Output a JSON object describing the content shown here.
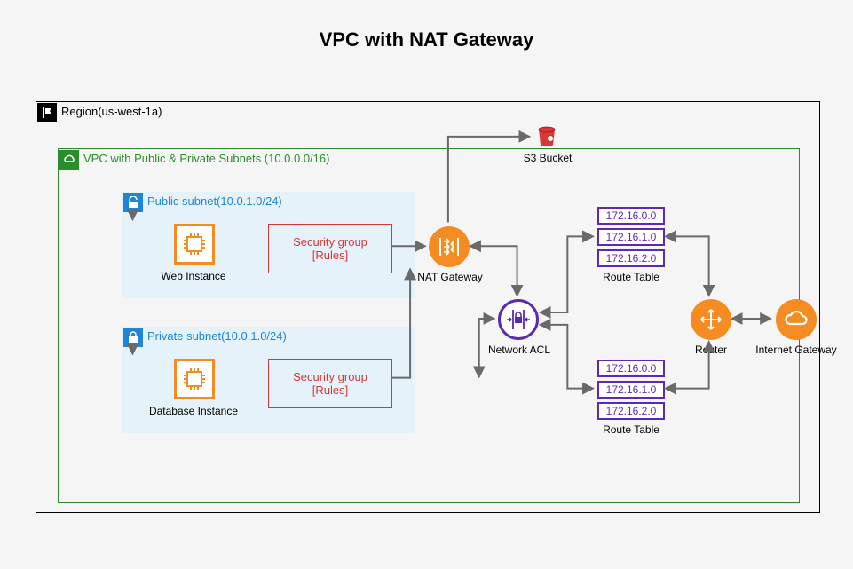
{
  "title": "VPC with NAT Gateway",
  "region": {
    "label": "Region(us-west-1a)"
  },
  "vpc": {
    "label": "VPC with Public & Private Subnets (10.0.0.0/16)"
  },
  "public_subnet": {
    "label": "Public subnet(10.0.1.0/24)"
  },
  "private_subnet": {
    "label": "Private subnet(10.0.1.0/24)"
  },
  "web_instance": {
    "label": "Web Instance"
  },
  "db_instance": {
    "label": "Database Instance"
  },
  "secgroup1": {
    "title": "Security group",
    "rules": "[Rules]"
  },
  "secgroup2": {
    "title": "Security group",
    "rules": "[Rules]"
  },
  "nat": {
    "label": "NAT Gateway"
  },
  "nacl": {
    "label": "Network ACL"
  },
  "s3": {
    "label": "S3 Bucket"
  },
  "router": {
    "label": "Router"
  },
  "igw": {
    "label": "Internet Gateway"
  },
  "route_table_top": {
    "label": "Route Table",
    "ips": [
      "172.16.0.0",
      "172.16.1.0",
      "172.16.2.0"
    ]
  },
  "route_table_bottom": {
    "label": "Route Table",
    "ips": [
      "172.16.0.0",
      "172.16.1.0",
      "172.16.2.0"
    ]
  }
}
